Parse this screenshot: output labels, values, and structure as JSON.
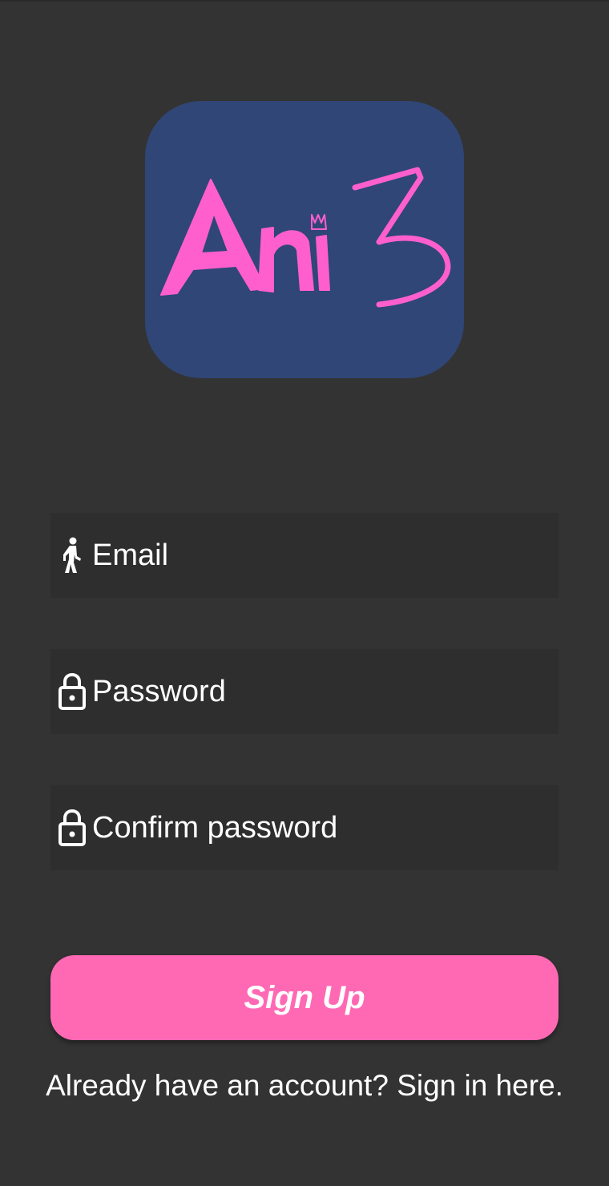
{
  "app": {
    "logo_text": "AniZ",
    "brand_color": "#ff69b4",
    "logo_background": "#2f4676",
    "background": "#333333"
  },
  "form": {
    "email": {
      "placeholder": "Email",
      "value": "",
      "icon": "walking-person-icon"
    },
    "password": {
      "placeholder": "Password",
      "value": "",
      "icon": "lock-icon"
    },
    "confirm_password": {
      "placeholder": "Confirm password",
      "value": "",
      "icon": "lock-icon"
    }
  },
  "actions": {
    "signup_label": "Sign Up",
    "signin_prompt": "Already have an account? Sign in here."
  }
}
